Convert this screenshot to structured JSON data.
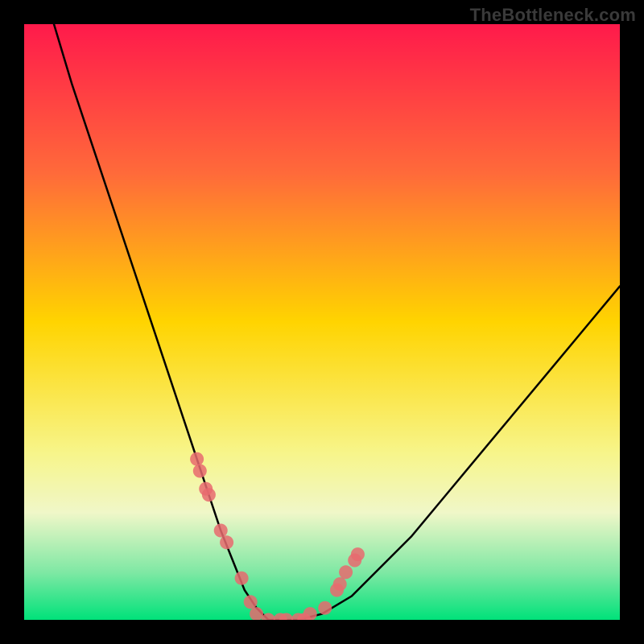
{
  "watermark": "TheBottleneck.com",
  "chart_data": {
    "type": "line",
    "title": "",
    "xlabel": "",
    "ylabel": "",
    "xlim": [
      0,
      100
    ],
    "ylim": [
      0,
      100
    ],
    "grid": false,
    "series": [
      {
        "name": "bottleneck-curve",
        "x": [
          5,
          8,
          12,
          16,
          20,
          24,
          27,
          29,
          31,
          33,
          35,
          37,
          39,
          41,
          43,
          46,
          50,
          55,
          60,
          65,
          70,
          75,
          80,
          85,
          90,
          95,
          100
        ],
        "y": [
          100,
          90,
          78,
          66,
          54,
          42,
          33,
          27,
          21,
          15,
          10,
          5,
          2,
          0,
          0,
          0,
          1,
          4,
          9,
          14,
          20,
          26,
          32,
          38,
          44,
          50,
          56
        ]
      }
    ],
    "markers": {
      "name": "scatter-points",
      "x": [
        29,
        29.5,
        30.5,
        31,
        33,
        34,
        36.5,
        38,
        39,
        41,
        43,
        44,
        46,
        47,
        48,
        50.5,
        52.5,
        53,
        54,
        55.5,
        56
      ],
      "y": [
        27,
        25,
        22,
        21,
        15,
        13,
        7,
        3,
        1,
        0,
        0,
        0,
        0,
        0,
        1,
        2,
        5,
        6,
        8,
        10,
        11
      ]
    },
    "gradient_stops": [
      {
        "offset": 0.0,
        "color": "#ff1a4b"
      },
      {
        "offset": 0.25,
        "color": "#ff6a3a"
      },
      {
        "offset": 0.5,
        "color": "#ffd400"
      },
      {
        "offset": 0.72,
        "color": "#f7f58a"
      },
      {
        "offset": 0.82,
        "color": "#f0f7c8"
      },
      {
        "offset": 0.92,
        "color": "#7fe8a4"
      },
      {
        "offset": 1.0,
        "color": "#00e27a"
      }
    ],
    "marker_color": "#e86a6f",
    "curve_color": "#000000"
  }
}
